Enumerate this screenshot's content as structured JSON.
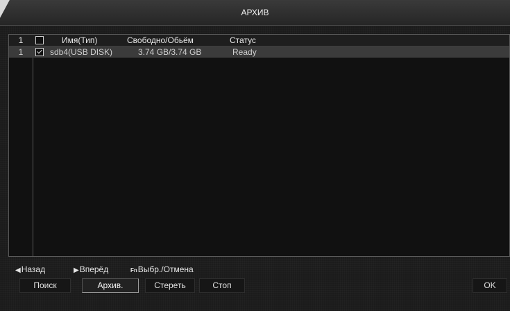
{
  "title": "АРХИВ",
  "table": {
    "header": {
      "num": "1",
      "name": "Имя(Тип)",
      "free": "Свободно/Обьём",
      "status": "Статус"
    },
    "rows": [
      {
        "num": "1",
        "checked": true,
        "name": "sdb4(USB DISK)",
        "free": "3.74 GB/3.74 GB",
        "status": "Ready"
      }
    ]
  },
  "nav": {
    "prev_icon": "◀",
    "prev": "Назад",
    "next_icon": "▶",
    "next": "Вперёд",
    "fn_icon": "Fn",
    "select": "Выбр./Отмена"
  },
  "buttons": {
    "search": "Поиск",
    "archive": "Архив.",
    "erase": "Стереть",
    "stop": "Стоп",
    "ok": "OK"
  }
}
